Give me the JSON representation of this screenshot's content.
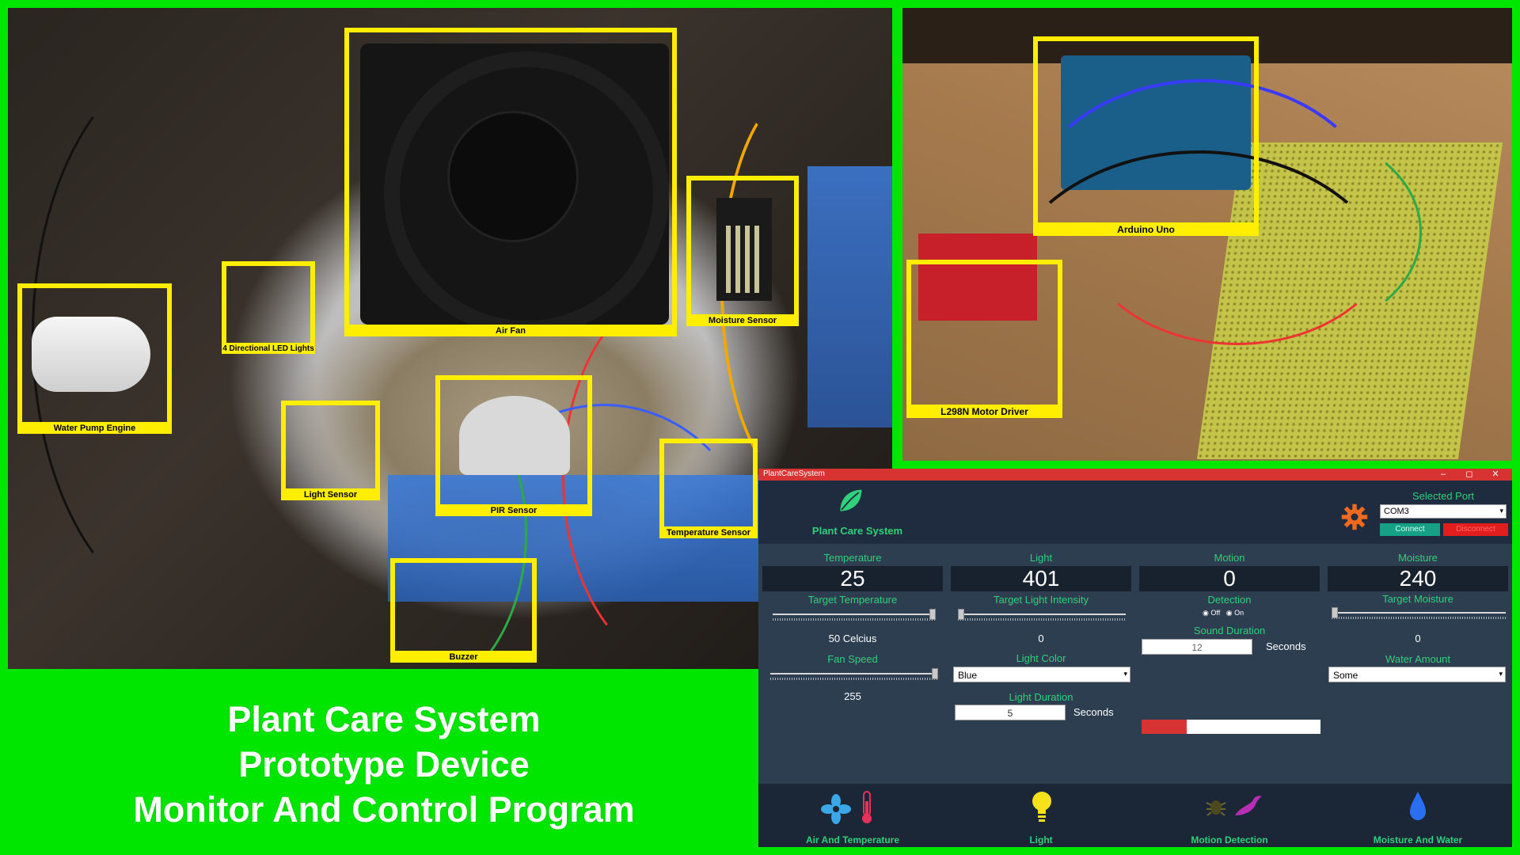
{
  "photo_labels": {
    "water_pump": "Water Pump Engine",
    "led_lights": "4 Directional LED Lights",
    "air_fan": "Air Fan",
    "moisture_sensor": "Moisture Sensor",
    "light_sensor": "Light Sensor",
    "pir_sensor": "PIR Sensor",
    "temperature_sensor": "Temperature Sensor",
    "buzzer": "Buzzer",
    "arduino": "Arduino Uno",
    "motor_driver": "L298N Motor Driver"
  },
  "caption": {
    "line1": "Plant Care System",
    "line2": "Prototype Device",
    "line3": "Monitor And Control Program"
  },
  "app": {
    "window_title": "PlantCareSystem",
    "controls": {
      "minimize": "–",
      "maximize": "◻",
      "close": "✕"
    },
    "brand": "Plant Care System",
    "port": {
      "title": "Selected Port",
      "value": "COM3",
      "connect": "Connect",
      "disconnect": "Disconnect"
    },
    "temperature": {
      "title": "Temperature",
      "value": "25",
      "target_label": "Target Temperature",
      "target_value": "50 Celcius",
      "target_fraction": 1.0,
      "fan_label": "Fan Speed",
      "fan_value": "255",
      "fan_fraction": 1.0
    },
    "light": {
      "title": "Light",
      "value": "401",
      "target_label": "Target Light Intensity",
      "target_value": "0",
      "target_fraction": 0.0,
      "color_label": "Light Color",
      "color_value": "Blue",
      "duration_label": "Light Duration",
      "duration_value": "5",
      "duration_unit": "Seconds"
    },
    "motion": {
      "title": "Motion",
      "value": "0",
      "detection_label": "Detection",
      "off_label": "Off",
      "on_label": "On",
      "sound_label": "Sound Duration",
      "sound_value": "12",
      "sound_unit": "Seconds",
      "progress_fraction": 0.25
    },
    "moisture": {
      "title": "Moisture",
      "value": "240",
      "target_label": "Target Moisture",
      "target_value": "0",
      "target_fraction": 0.0,
      "water_label": "Water Amount",
      "water_value": "Some"
    },
    "nav": {
      "air": "Air And Temperature",
      "light": "Light",
      "motion": "Motion Detection",
      "moisture": "Moisture And Water"
    },
    "colors": {
      "accent": "#2fd17a",
      "panel": "#2d3e50",
      "header": "#1f2b3e",
      "alert": "#e11d1d"
    }
  }
}
